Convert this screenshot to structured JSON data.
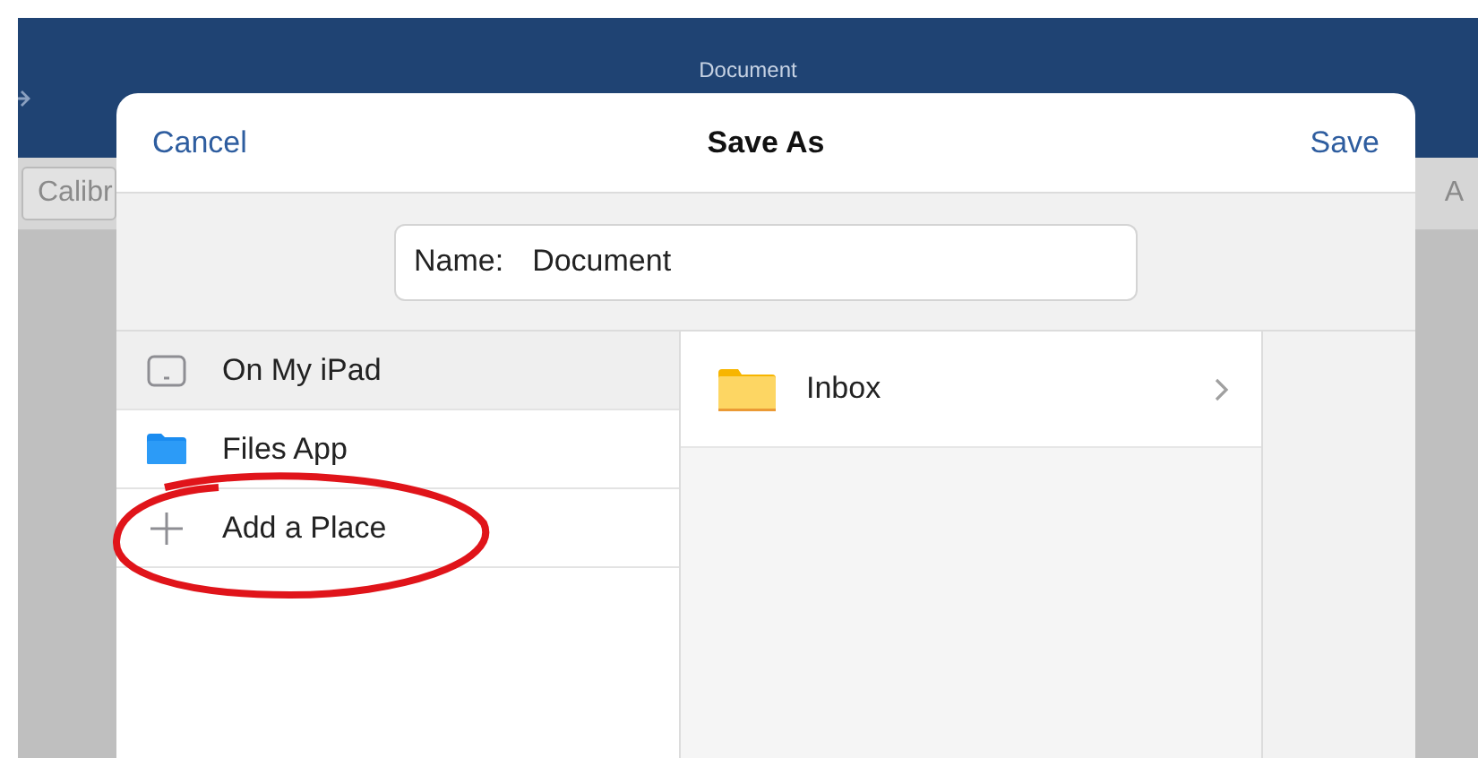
{
  "background_app": {
    "title": "Document",
    "font_field": "Calibr",
    "format_glyph": "A"
  },
  "dialog": {
    "cancel": "Cancel",
    "title": "Save As",
    "save": "Save",
    "name_label": "Name:",
    "name_value": "Document"
  },
  "locations": [
    {
      "kind": "device",
      "label": "On My iPad",
      "selected": true
    },
    {
      "kind": "folder",
      "label": "Files App",
      "selected": false
    },
    {
      "kind": "add",
      "label": "Add a Place",
      "selected": false
    }
  ],
  "folders": [
    {
      "label": "Inbox"
    }
  ]
}
